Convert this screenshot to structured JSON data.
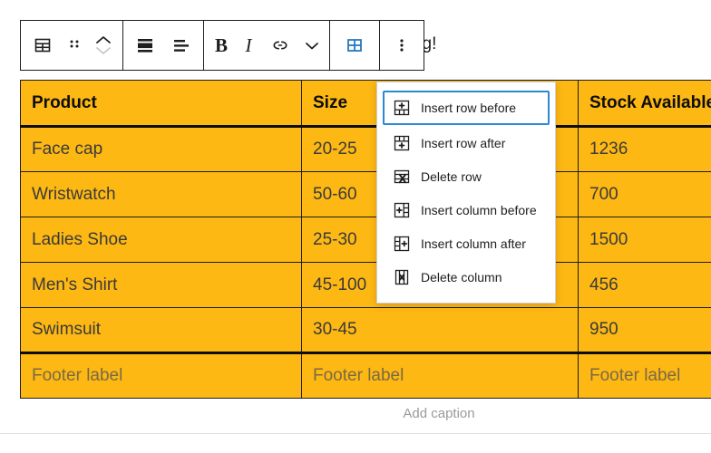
{
  "editor": {
    "background_paragraph": "Type / to choose a block, or delete it, then start writing!",
    "caption_placeholder": "Add caption"
  },
  "toolbar": {
    "groups": [
      {
        "name": "block-controls",
        "buttons": [
          {
            "name": "block-type-table-icon",
            "label": "Table",
            "icon": "table-icon"
          },
          {
            "name": "drag-handle-icon",
            "label": "Drag",
            "icon": "drag-dots-icon"
          },
          {
            "name": "move-updown-icon",
            "label": "Move up or down",
            "icon": "chevron-up-down-icon"
          }
        ]
      },
      {
        "name": "alignment-controls",
        "buttons": [
          {
            "name": "change-alignment-icon",
            "label": "Align",
            "icon": "align-block-icon"
          },
          {
            "name": "align-text-icon",
            "label": "Align text",
            "icon": "align-text-icon"
          }
        ]
      },
      {
        "name": "text-formatting",
        "buttons": [
          {
            "name": "bold-button",
            "label": "B",
            "icon": "bold-icon"
          },
          {
            "name": "italic-button",
            "label": "I",
            "icon": "italic-icon"
          },
          {
            "name": "link-button",
            "label": "Link",
            "icon": "link-icon"
          },
          {
            "name": "more-formatting-button",
            "label": "More",
            "icon": "chevron-down-icon"
          }
        ]
      },
      {
        "name": "table-controls",
        "buttons": [
          {
            "name": "edit-table-button",
            "label": "Edit table",
            "icon": "table-icon-active"
          }
        ]
      },
      {
        "name": "block-options",
        "buttons": [
          {
            "name": "block-options-button",
            "label": "Options",
            "icon": "kebab-menu-icon"
          }
        ]
      }
    ],
    "accent_color": "#2779bd"
  },
  "table_menu": {
    "focused_index": 0,
    "items": [
      {
        "label": "Insert row before",
        "icon": "insert-row-before-icon"
      },
      {
        "label": "Insert row after",
        "icon": "insert-row-after-icon"
      },
      {
        "label": "Delete row",
        "icon": "delete-row-icon"
      },
      {
        "label": "Insert column before",
        "icon": "insert-column-before-icon"
      },
      {
        "label": "Insert column after",
        "icon": "insert-column-after-icon"
      },
      {
        "label": "Delete column",
        "icon": "delete-column-icon"
      }
    ],
    "focus_ring_color": "#2a89d4"
  },
  "table": {
    "background_color": "#fdb813",
    "border_color": "#1e1e1e",
    "headers": [
      "Product",
      "Size",
      "Stock Available"
    ],
    "rows": [
      [
        "Face cap",
        "20-25",
        "1236"
      ],
      [
        "Wristwatch",
        "50-60",
        "700"
      ],
      [
        "Ladies Shoe",
        "25-30",
        "1500"
      ],
      [
        "Men's Shirt",
        "45-100",
        "456"
      ],
      [
        "Swimsuit",
        "30-45",
        "950"
      ]
    ],
    "footer": [
      "Footer label",
      "Footer label",
      "Footer label"
    ]
  }
}
